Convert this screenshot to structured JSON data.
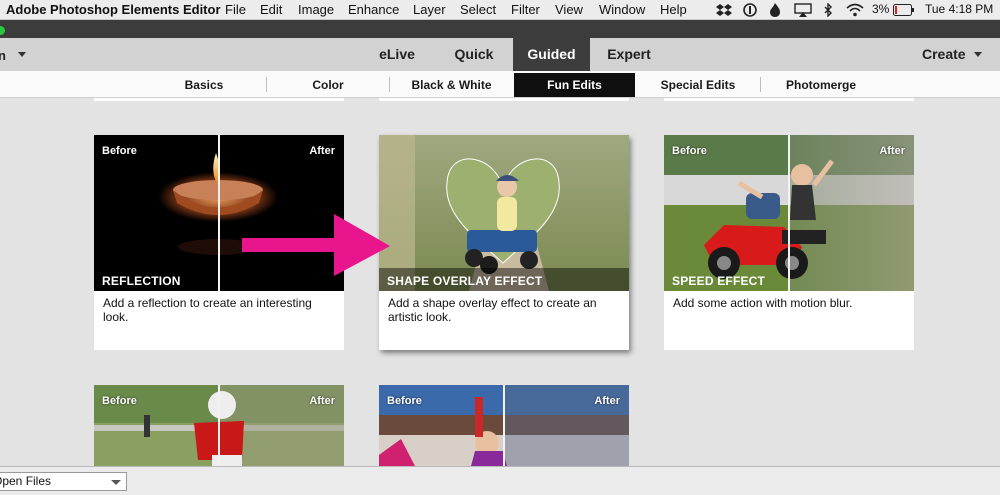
{
  "menubar": {
    "app_name": "Adobe Photoshop Elements Editor",
    "items": [
      "File",
      "Edit",
      "Image",
      "Enhance",
      "Layer",
      "Select",
      "Filter",
      "View",
      "Window",
      "Help"
    ],
    "battery": "3%",
    "clock": "Tue 4:18 PM"
  },
  "modes": {
    "items": [
      "eLive",
      "Quick",
      "Guided",
      "Expert"
    ],
    "active": "Guided",
    "create_label": "Create"
  },
  "subtabs": {
    "items": [
      "Basics",
      "Color",
      "Black & White",
      "Fun Edits",
      "Special Edits",
      "Photomerge"
    ],
    "active": "Fun Edits"
  },
  "cards": [
    {
      "title": "REFLECTION",
      "description": "Add a reflection to create an interesting look.",
      "before": "Before",
      "after": "After"
    },
    {
      "title": "SHAPE OVERLAY EFFECT",
      "description": "Add a shape overlay effect to create an artistic look.",
      "before": "",
      "after": ""
    },
    {
      "title": "SPEED EFFECT",
      "description": "Add some action with motion blur.",
      "before": "Before",
      "after": "After"
    },
    {
      "title": "",
      "description": "",
      "before": "Before",
      "after": "After"
    },
    {
      "title": "",
      "description": "",
      "before": "Before",
      "after": "After"
    }
  ],
  "bottom": {
    "dropdown_label": "Open Files"
  },
  "colors": {
    "arrow": "#e8158c",
    "active_mode_bg": "#3d3d3d",
    "active_tab_bg": "#0f0f0f"
  }
}
